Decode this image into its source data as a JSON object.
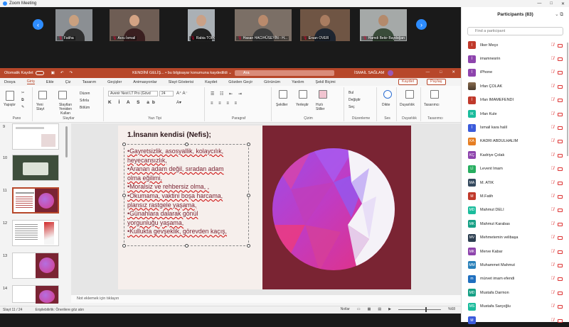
{
  "window": {
    "title": "Zoom Meeting",
    "controls": [
      "—",
      "□",
      "✕"
    ]
  },
  "gallery": {
    "prev": "‹",
    "next": "›",
    "tiles": [
      {
        "name": "Fatiha",
        "face": "#c9a07f",
        "bg": "#8b8f93",
        "body": "#2f2f2f"
      },
      {
        "name": "Arzu İsmail",
        "face": "#d3a384",
        "bg": "#6e5d54",
        "body": "#3a1f20"
      },
      {
        "name": "Rabia TOPÇU",
        "face": "#caa187",
        "bg": "#aab0b5",
        "body": "#222"
      },
      {
        "name": "Hasan HACIHÜSEYİN - H...",
        "face": "#b98a6c",
        "bg": "#7b6f66",
        "body": "#3d3d3d"
      },
      {
        "name": "Ersan OVER",
        "face": "#a97c60",
        "bg": "#6f5544",
        "body": "#1e2530"
      },
      {
        "name": "Hamdi Bekir Baydoğan",
        "face": "#b48a6c",
        "bg": "#a5a9a8",
        "body": "#3a4c3a"
      }
    ]
  },
  "ppt": {
    "autosave": "Otomatik Kaydet",
    "doc": "KENDİNİ GELİŞ... • bu bilgisayar konumuna kaydedildi ⌄",
    "search": "Ara",
    "user": "İSMAİL SAĞLAM",
    "menus": [
      "Dosya",
      "Giriş",
      "Ekle",
      "Çiz",
      "Tasarım",
      "Geçişler",
      "Animasyonlar",
      "Slayt Gösterisi",
      "Kaydet",
      "Gözden Geçir",
      "Görünüm",
      "Yardım",
      "Şekil Biçimi"
    ],
    "active_menu": "Giriş",
    "record_btn": "Kaydet",
    "share_btn": "Paylaş",
    "ribbon": {
      "paste": "Yapıştır",
      "clipboard": "Pano",
      "new_slide": "Yeni Slayt",
      "reuse": "Slaytları Yeniden Kullan",
      "layout": "Düzen",
      "reset": "Sıfırla",
      "section": "Bölüm",
      "slides_grp": "Slaytlar",
      "font": "Avenir Next LT Pro (Gövd",
      "size": "24",
      "font_grp": "Yazı Tipi",
      "para_grp": "Paragraf",
      "shapes": "Şekiller",
      "arrange": "Yerleştir",
      "quick_styles": "Hızlı Stiller",
      "draw_grp": "Çizim",
      "find": "Bul",
      "replace": "Değiştir",
      "select": "Seç",
      "edit_grp": "Düzenleme",
      "dictate": "Dikte",
      "voice_grp": "Ses",
      "sensitivity": "Duyarlılık",
      "sens_grp": "Duyarlılık",
      "designer": "Tasarımcı",
      "designer_grp": "Tasarımcı"
    },
    "slide_numbers": [
      "9",
      "10",
      "11",
      "12",
      "13",
      "14"
    ],
    "slide": {
      "title": "1.İnsanın kendisi (Nefis);",
      "bullets": [
        "•Gayretsizlik, asosyallik, kolaycılık,",
        "heyecansızlık,",
        "•Aranan adam değil, sıradan adam",
        "olma eğilimi,",
        "•Moralsiz ve rehbersiz olma, ,",
        "•Okumama, vaktini boşa harcama,",
        "plansız rastgele yaşama,",
        "•Günahlara dalarak gönül",
        "yorgunluğu yaşama,",
        "•Kullukta gevşeklik, görevden kaçış,"
      ]
    },
    "notes": "Not eklemek için tıklayın",
    "status": {
      "slide": "Slayt 11 / 24",
      "accessibility": "Erişilebilirlik: Önerilere göz atın",
      "notes": "Notlar",
      "zoom": "%68"
    }
  },
  "participants": {
    "header": "Participants (83)",
    "search_placeholder": "Find a participant",
    "list": [
      {
        "initials": "İ",
        "name": "İlker Meço",
        "color": "#c0392b"
      },
      {
        "initials": "İ",
        "name": "imamnesrin",
        "color": "#8e44ad"
      },
      {
        "initials": "İ",
        "name": "iPhone",
        "color": "#8e44ad"
      },
      {
        "initials": "İ",
        "name": "İrfan ÇOLAK",
        "color": "#7f6a4f",
        "photo": true
      },
      {
        "initials": "İ",
        "name": "İrfan İMAMEFENDİ",
        "color": "#c0392b"
      },
      {
        "initials": "IK",
        "name": "İrfan Kule",
        "color": "#1abc9c"
      },
      {
        "initials": "İ",
        "name": "İsmail kara halil",
        "color": "#3b5bdb"
      },
      {
        "initials": "KA",
        "name": "KADRİ ABDULHALİM",
        "color": "#e67e22"
      },
      {
        "initials": "KÇ",
        "name": "Kadriye Çolak",
        "color": "#8e44ad"
      },
      {
        "initials": "Lİ",
        "name": "Levent İmam",
        "color": "#27ae60"
      },
      {
        "initials": "MA",
        "name": "M. ATİK",
        "color": "#34495e"
      },
      {
        "initials": "M",
        "name": "M.Fatih",
        "color": "#c0392b"
      },
      {
        "initials": "MD",
        "name": "Mahmut DELİ",
        "color": "#1abc9c"
      },
      {
        "initials": "MK",
        "name": "Mahmut Karabas",
        "color": "#16a085"
      },
      {
        "initials": "MV",
        "name": "Mehmetemin velibaşa",
        "color": "#2c3e50"
      },
      {
        "initials": "MK",
        "name": "Merve Kabar",
        "color": "#8e44ad"
      },
      {
        "initials": "MM",
        "name": "Muhammet Mahmut",
        "color": "#2980b9"
      },
      {
        "initials": "m",
        "name": "mürvet imam efendi",
        "color": "#1f6fbf"
      },
      {
        "initials": "MD",
        "name": "Mustafa Darmon",
        "color": "#16a085"
      },
      {
        "initials": "MS",
        "name": "Mustafa Sarçoğlu",
        "color": "#1abc9c"
      },
      {
        "initials": "M",
        "name": "",
        "color": "#3b5bdb"
      }
    ]
  }
}
